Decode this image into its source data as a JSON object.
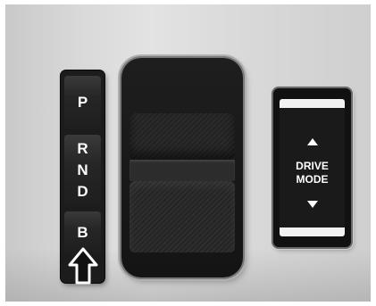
{
  "gear_selector": {
    "park": "P",
    "rnd": [
      "R",
      "N",
      "D"
    ],
    "brake": "B",
    "arrow_icon": "arrow-up-outline-icon"
  },
  "drive_mode": {
    "line1": "DRIVE",
    "line2": "MODE",
    "up_icon": "triangle-up-icon",
    "down_icon": "triangle-down-icon"
  }
}
